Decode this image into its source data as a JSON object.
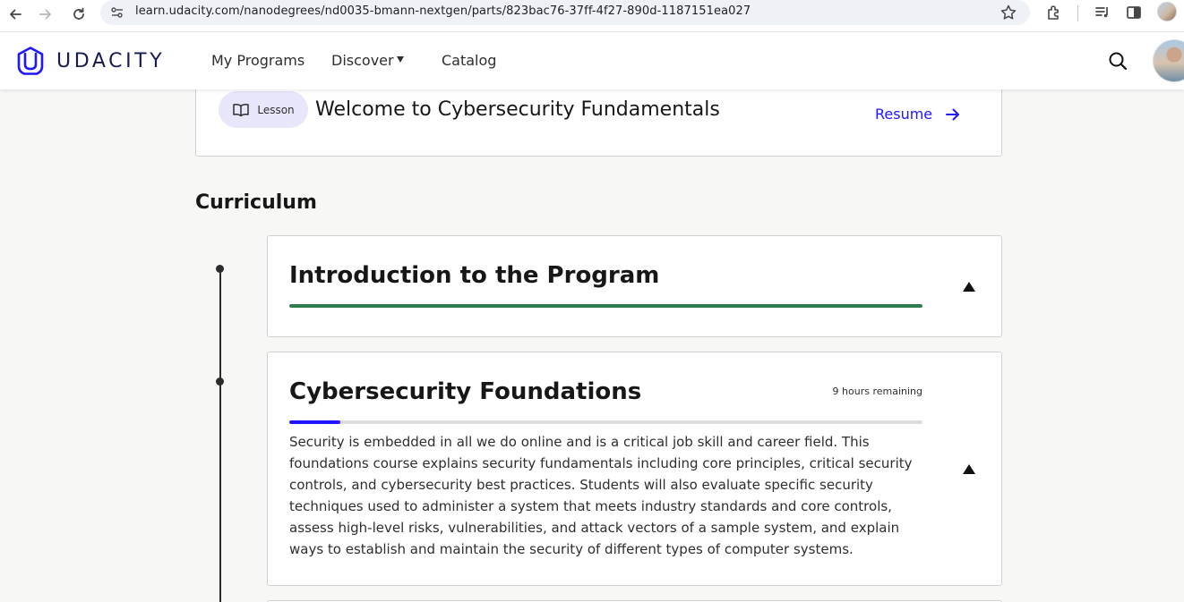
{
  "browser": {
    "url": "learn.udacity.com/nanodegrees/nd0035-bmann-nextgen/parts/823bac76-37ff-4f27-890d-1187151ea027",
    "icons": [
      "back-icon",
      "forward-icon",
      "reload-icon",
      "site-info-icon",
      "star-icon",
      "extensions-icon",
      "media-icon",
      "side-panel-icon",
      "profile-icon"
    ]
  },
  "header": {
    "logo_text": "UDACITY",
    "nav": {
      "my_programs": "My Programs",
      "discover": "Discover",
      "catalog": "Catalog"
    },
    "icons": [
      "search-icon",
      "caret-down-icon"
    ]
  },
  "lesson": {
    "badge_label": "Lesson",
    "title": "Welcome to Cybersecurity Fundamentals",
    "resume_label": "Resume"
  },
  "curriculum": {
    "heading": "Curriculum",
    "modules": [
      {
        "title": "Introduction to the Program",
        "progress_percent": 100,
        "progress_color": "#2f7d4e",
        "remaining": "",
        "description": ""
      },
      {
        "title": "Cybersecurity Foundations",
        "progress_percent": 8,
        "progress_color": "#2015ff",
        "remaining": "9 hours remaining",
        "description": "Security is embedded in all we do online and is a critical job skill and career field. This foundations course explains security fundamentals including core principles, critical security controls, and cybersecurity best practices. Students will also evaluate specific security techniques used to administer a system that meets industry standards and core controls, assess high-level risks, vulnerabilities, and attack vectors of a sample system, and explain ways to establish and maintain the security of different types of computer systems."
      }
    ]
  },
  "colors": {
    "brand": "#2015ff",
    "logo": "#171a53",
    "complete": "#2f7d4e",
    "background": "#f7f7f5",
    "lesson_pill": "#e8e6fb"
  }
}
